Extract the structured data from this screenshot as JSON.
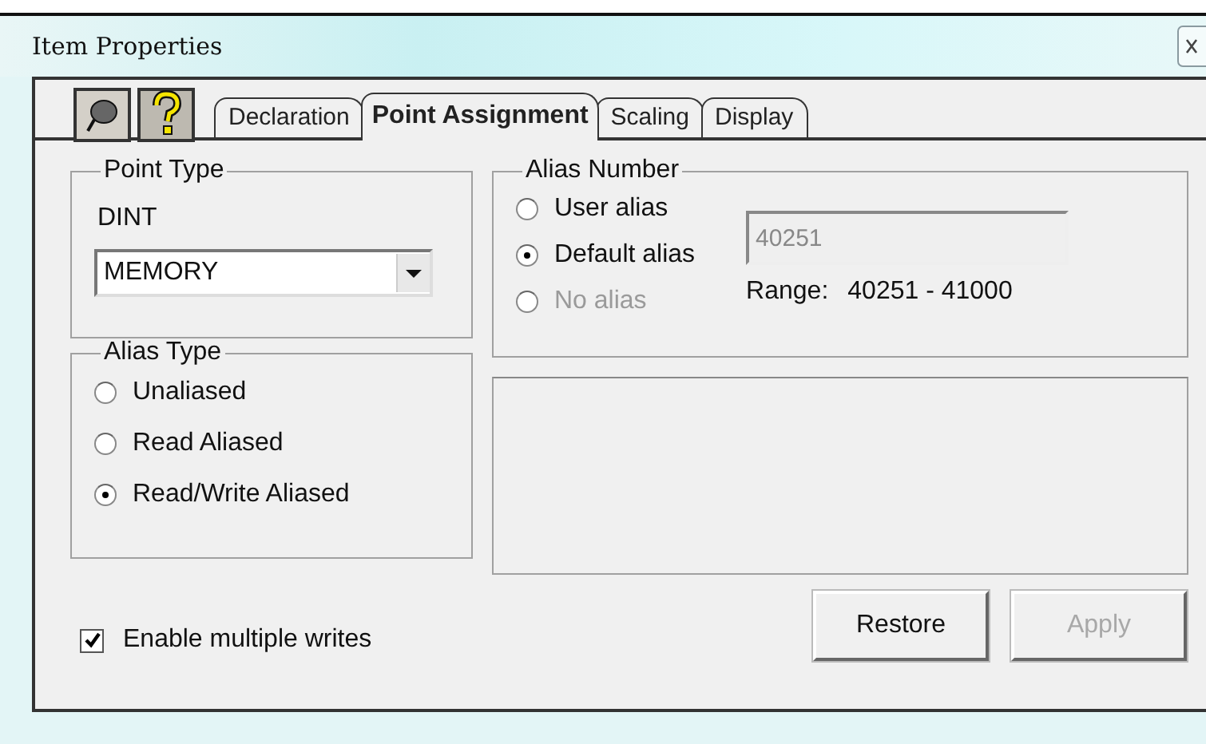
{
  "window": {
    "title": "Item Properties"
  },
  "tabs": [
    {
      "label": "Declaration",
      "selected": false
    },
    {
      "label": "Point Assignment",
      "selected": true
    },
    {
      "label": "Scaling",
      "selected": false
    },
    {
      "label": "Display",
      "selected": false
    }
  ],
  "point_type": {
    "title": "Point Type",
    "type": "DINT",
    "dropdown": {
      "value": "MEMORY"
    }
  },
  "alias_type": {
    "title": "Alias Type",
    "options": [
      {
        "label": "Unaliased",
        "selected": false
      },
      {
        "label": "Read Aliased",
        "selected": false
      },
      {
        "label": "Read/Write Aliased",
        "selected": true
      }
    ]
  },
  "alias_number": {
    "title": "Alias Number",
    "options": [
      {
        "label": "User alias",
        "selected": false,
        "disabled": false
      },
      {
        "label": "Default alias",
        "selected": true,
        "disabled": false
      },
      {
        "label": "No alias",
        "selected": false,
        "disabled": true
      }
    ],
    "field": {
      "value": "40251",
      "disabled": true
    },
    "range_label": "Range:",
    "range": "40251 - 41000"
  },
  "checkbox": {
    "label": "Enable multiple writes",
    "checked": true
  },
  "buttons": [
    {
      "label": "Restore",
      "disabled": false
    },
    {
      "label": "Apply",
      "disabled": true
    }
  ]
}
